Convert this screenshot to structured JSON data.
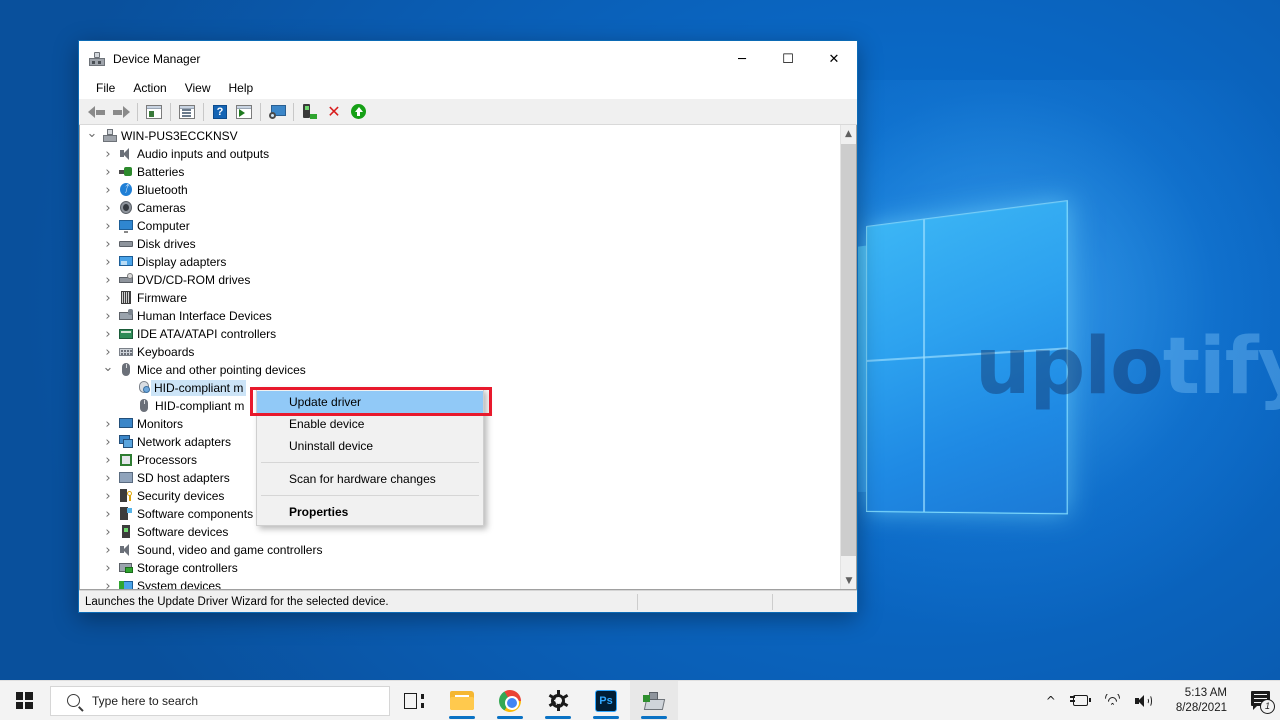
{
  "desktop": {
    "wallpaper_watermark": "uplotify",
    "wallpaper_watermark_light": "tify",
    "wallpaper_watermark_dark": "uplo"
  },
  "window": {
    "title": "Device Manager",
    "icon": "device-manager-icon",
    "controls": {
      "minimize": "─",
      "maximize": "☐",
      "close": "✕"
    },
    "menubar": [
      "File",
      "Action",
      "View",
      "Help"
    ],
    "toolbar": [
      {
        "name": "back-button",
        "icon": "back-arrow-icon"
      },
      {
        "name": "forward-button",
        "icon": "forward-arrow-icon"
      },
      {
        "name": "separator-1",
        "icon": "separator"
      },
      {
        "name": "show-hide-console-tree-button",
        "icon": "console-tree-icon"
      },
      {
        "name": "separator-2",
        "icon": "separator"
      },
      {
        "name": "properties-button",
        "icon": "properties-icon"
      },
      {
        "name": "separator-3",
        "icon": "separator"
      },
      {
        "name": "help-button",
        "icon": "help-icon"
      },
      {
        "name": "update-driver-button",
        "icon": "update-driver-icon"
      },
      {
        "name": "separator-4",
        "icon": "separator"
      },
      {
        "name": "scan-for-hardware-changes-button",
        "icon": "scan-monitor-icon"
      },
      {
        "name": "separator-5",
        "icon": "separator"
      },
      {
        "name": "enable-device-button",
        "icon": "enable-device-icon"
      },
      {
        "name": "uninstall-device-button",
        "icon": "red-x-icon"
      },
      {
        "name": "update-button",
        "icon": "green-up-arrow-icon"
      }
    ]
  },
  "tree": {
    "root": {
      "label": "WIN-PUS3ECCKNSV",
      "icon": "computer-icon",
      "expanded": true
    },
    "items": [
      {
        "label": "Audio inputs and outputs",
        "icon": "speaker-icon",
        "expanded": false,
        "indent": 1
      },
      {
        "label": "Batteries",
        "icon": "battery-icon",
        "expanded": false,
        "indent": 1
      },
      {
        "label": "Bluetooth",
        "icon": "bluetooth-icon",
        "expanded": false,
        "indent": 1
      },
      {
        "label": "Cameras",
        "icon": "camera-icon",
        "expanded": false,
        "indent": 1
      },
      {
        "label": "Computer",
        "icon": "computer-monitor-icon",
        "expanded": false,
        "indent": 1
      },
      {
        "label": "Disk drives",
        "icon": "disk-drive-icon",
        "expanded": false,
        "indent": 1
      },
      {
        "label": "Display adapters",
        "icon": "display-adapter-icon",
        "expanded": false,
        "indent": 1
      },
      {
        "label": "DVD/CD-ROM drives",
        "icon": "dvd-drive-icon",
        "expanded": false,
        "indent": 1
      },
      {
        "label": "Firmware",
        "icon": "firmware-icon",
        "expanded": false,
        "indent": 1
      },
      {
        "label": "Human Interface Devices",
        "icon": "hid-icon",
        "expanded": false,
        "indent": 1
      },
      {
        "label": "IDE ATA/ATAPI controllers",
        "icon": "ide-controller-icon",
        "expanded": false,
        "indent": 1
      },
      {
        "label": "Keyboards",
        "icon": "keyboard-icon",
        "expanded": false,
        "indent": 1
      },
      {
        "label": "Mice and other pointing devices",
        "icon": "mouse-icon",
        "expanded": true,
        "indent": 1
      },
      {
        "label": "HID-compliant m",
        "icon": "hid-mouse-icon",
        "expanded": null,
        "indent": 2,
        "selected": true
      },
      {
        "label": "HID-compliant m",
        "icon": "mouse-device-icon",
        "expanded": null,
        "indent": 2
      },
      {
        "label": "Monitors",
        "icon": "monitor-icon",
        "expanded": false,
        "indent": 1
      },
      {
        "label": "Network adapters",
        "icon": "network-adapter-icon",
        "expanded": false,
        "indent": 1
      },
      {
        "label": "Processors",
        "icon": "processor-icon",
        "expanded": false,
        "indent": 1
      },
      {
        "label": "SD host adapters",
        "icon": "sd-host-adapter-icon",
        "expanded": false,
        "indent": 1
      },
      {
        "label": "Security devices",
        "icon": "security-device-icon",
        "expanded": false,
        "indent": 1
      },
      {
        "label": "Software components",
        "icon": "software-component-icon",
        "expanded": false,
        "indent": 1
      },
      {
        "label": "Software devices",
        "icon": "software-device-icon",
        "expanded": false,
        "indent": 1
      },
      {
        "label": "Sound, video and game controllers",
        "icon": "sound-controller-icon",
        "expanded": false,
        "indent": 1
      },
      {
        "label": "Storage controllers",
        "icon": "storage-controller-icon",
        "expanded": false,
        "indent": 1
      },
      {
        "label": "System devices",
        "icon": "system-device-icon",
        "expanded": false,
        "indent": 1
      }
    ]
  },
  "context_menu": {
    "items": [
      {
        "label": "Update driver",
        "highlighted": true,
        "bold": false
      },
      {
        "label": "Enable device",
        "highlighted": false,
        "bold": false
      },
      {
        "label": "Uninstall device",
        "highlighted": false,
        "bold": false
      },
      {
        "separator": true
      },
      {
        "label": "Scan for hardware changes",
        "highlighted": false,
        "bold": false
      },
      {
        "separator": true
      },
      {
        "label": "Properties",
        "highlighted": false,
        "bold": true
      }
    ],
    "highlight_color": "#91c9f7",
    "annotation_box_color": "#e8192c"
  },
  "statusbar": {
    "text": "Launches the Update Driver Wizard for the selected device."
  },
  "taskbar": {
    "start": "windows-logo-icon",
    "search": {
      "placeholder": "Type here to search",
      "value": "",
      "icon": "search-icon"
    },
    "icons": [
      {
        "name": "task-view-button",
        "icon": "task-view-icon",
        "running": false,
        "active": false
      },
      {
        "name": "file-explorer-button",
        "icon": "file-explorer-icon",
        "running": true,
        "active": false
      },
      {
        "name": "chrome-button",
        "icon": "chrome-icon",
        "running": true,
        "active": false
      },
      {
        "name": "settings-button",
        "icon": "gear-icon",
        "running": true,
        "active": false
      },
      {
        "name": "photoshop-button",
        "icon": "photoshop-icon",
        "label": "Ps",
        "running": true,
        "active": false
      },
      {
        "name": "device-manager-button",
        "icon": "device-manager-icon",
        "running": true,
        "active": true
      }
    ],
    "tray": {
      "overflow": "chevron-up-icon",
      "battery": "battery-charging-icon",
      "network": "wifi-icon",
      "volume": "speaker-icon",
      "time": "5:13 AM",
      "date": "8/28/2021",
      "notifications": "action-center-icon",
      "notification_count": "1"
    }
  }
}
